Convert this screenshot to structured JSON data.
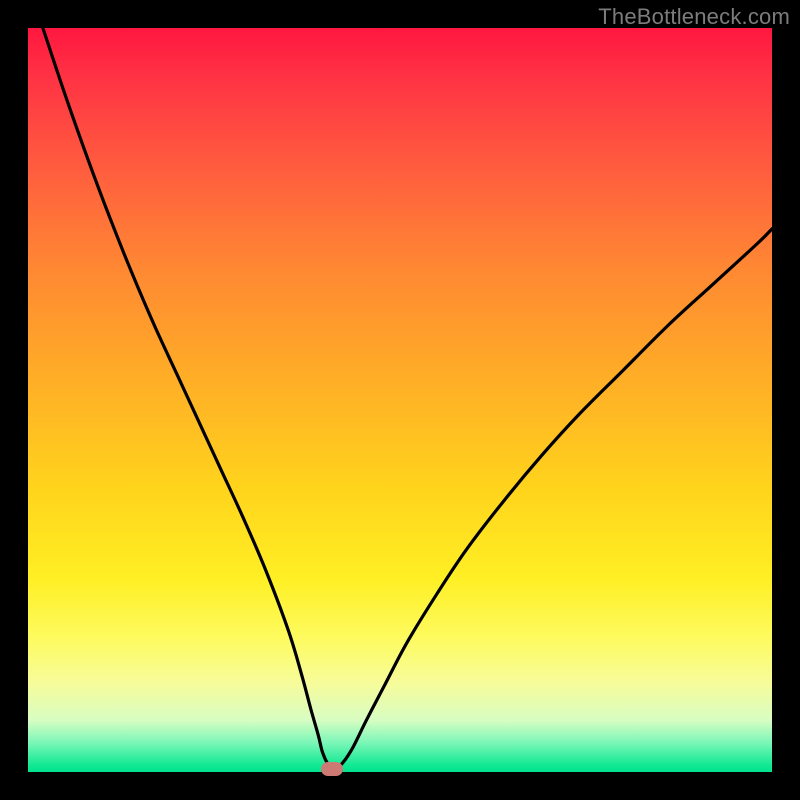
{
  "watermark": "TheBottleneck.com",
  "colors": {
    "curve": "#000000",
    "marker": "#cd7a74",
    "frame": "#000000"
  },
  "chart_data": {
    "type": "line",
    "title": "",
    "xlabel": "",
    "ylabel": "",
    "xlim": [
      0,
      100
    ],
    "ylim": [
      0,
      100
    ],
    "grid": false,
    "series": [
      {
        "name": "bottleneck-curve",
        "x": [
          2,
          5,
          8,
          11,
          14,
          17,
          20,
          23,
          26,
          29,
          32,
          35,
          36.8,
          38,
          39,
          39.6,
          40.4,
          41,
          42,
          43.5,
          45.5,
          48,
          51,
          55,
          59,
          64,
          69,
          74,
          80,
          86,
          92,
          98,
          100
        ],
        "values": [
          100,
          91,
          82.5,
          74.5,
          67,
          60,
          53.5,
          47,
          40.5,
          34,
          27,
          19,
          13,
          8.5,
          5,
          2.6,
          0.9,
          0.4,
          0.9,
          3,
          7,
          11.8,
          17.5,
          24,
          30,
          36.5,
          42.5,
          48,
          54,
          60,
          65.5,
          71,
          73
        ]
      }
    ],
    "annotations": [
      {
        "name": "min-marker",
        "x": 40.8,
        "y": 0.4,
        "shape": "pill",
        "color": "#cd7a74"
      }
    ],
    "gradient_stops": [
      {
        "pos": 0.0,
        "color": "#ff173f"
      },
      {
        "pos": 0.06,
        "color": "#ff3044"
      },
      {
        "pos": 0.18,
        "color": "#ff5a3f"
      },
      {
        "pos": 0.32,
        "color": "#ff8733"
      },
      {
        "pos": 0.48,
        "color": "#ffb026"
      },
      {
        "pos": 0.62,
        "color": "#ffd41c"
      },
      {
        "pos": 0.74,
        "color": "#ffef24"
      },
      {
        "pos": 0.82,
        "color": "#fdfb5f"
      },
      {
        "pos": 0.88,
        "color": "#f7fc9a"
      },
      {
        "pos": 0.93,
        "color": "#d8fdc2"
      },
      {
        "pos": 0.96,
        "color": "#7df7b8"
      },
      {
        "pos": 0.99,
        "color": "#15e994"
      },
      {
        "pos": 1.0,
        "color": "#00e28f"
      }
    ]
  }
}
